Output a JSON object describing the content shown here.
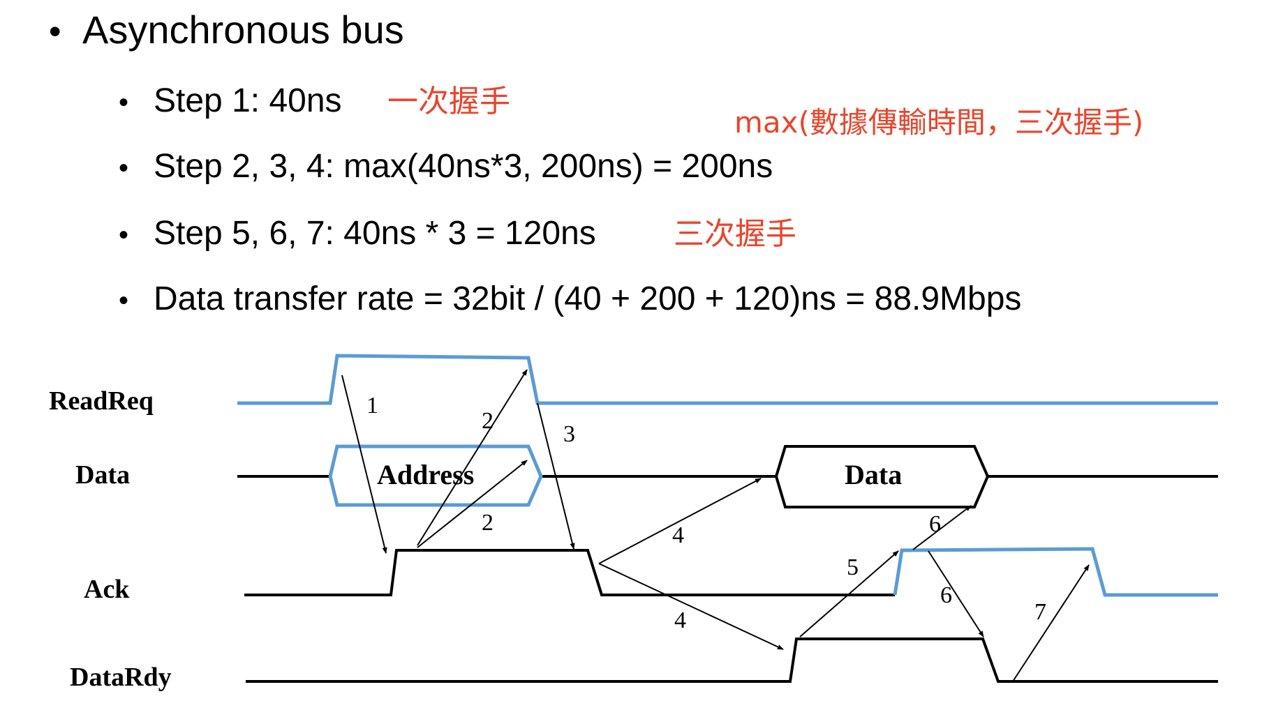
{
  "title": "Asynchronous bus",
  "bullets": [
    {
      "text": "Step 1: 40ns",
      "note": "一次握手"
    },
    {
      "text": "Step 2, 3, 4: max(40ns*3, 200ns) = 200ns",
      "note": ""
    },
    {
      "text": "Step 5, 6, 7: 40ns * 3 = 120ns",
      "note": "三次握手"
    },
    {
      "text": "Data transfer rate = 32bit / (40 + 200 + 120)ns = 88.9Mbps",
      "note": ""
    }
  ],
  "side_note": "max(數據傳輸時間，三次握手)",
  "bullet_char": "•",
  "diagram": {
    "signals": [
      "ReadReq",
      "Data",
      "Ack",
      "DataRdy"
    ],
    "boxes": [
      "Address",
      "Data"
    ],
    "step_labels": [
      "1",
      "2",
      "2",
      "3",
      "4",
      "4",
      "5",
      "6",
      "6",
      "7"
    ]
  },
  "colors": {
    "blue": "#5b9bd5",
    "black": "#000000",
    "red": "#e8452c"
  }
}
